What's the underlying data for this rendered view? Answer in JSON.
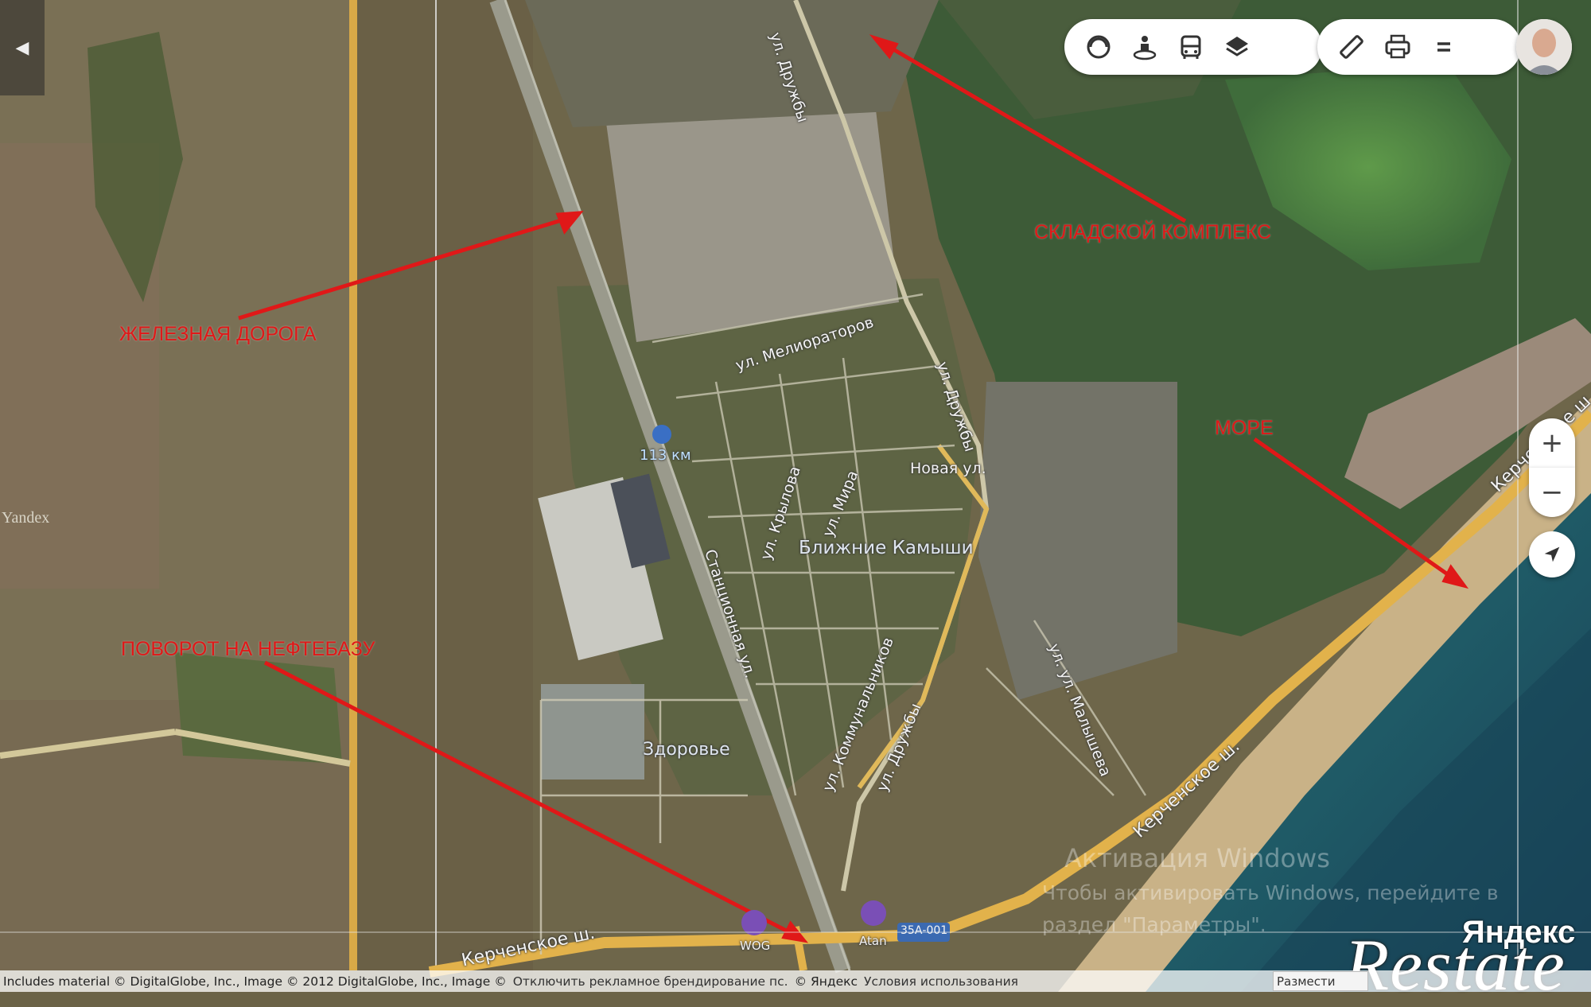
{
  "map": {
    "streets": {
      "druzhby_top": "ул. Дружбы",
      "melioratorov": "ул. Мелиораторов",
      "druzhby_mid": "ул. Дружбы",
      "novaya": "Новая ул.",
      "krylova": "ул. Крылова",
      "mira": "ул. Мира",
      "stantsionnaya": "Станционная ул.",
      "kommunalnikov": "ул. Коммунальников",
      "druzhby_low": "ул. Дружбы",
      "malysheva": "ул. ул. Малышева",
      "kerchenskoe_left": "Керченское ш.",
      "kerchenskoe_mid": "Керченское ш.",
      "kerchenskoe_right": "Керченское ш."
    },
    "places": {
      "settlement": "Ближние Камыши",
      "zdorovye": "Здоровье",
      "station": "113 км",
      "wog": "WOG",
      "atan": "Atan",
      "road_code": "35А-001"
    },
    "annotations": {
      "railway": "ЖЕЛЕЗНАЯ ДОРОГА",
      "warehouse": "СКЛАДСКОЙ КОМПЛЕКС",
      "sea": "МОРЕ",
      "turn": "ПОВОРОТ НА НЕФТЕБАЗУ"
    },
    "annotation_color": "#e01818",
    "side_brand": "Yandex"
  },
  "toolbar": {
    "group1_icons": [
      "traffic-icon",
      "panorama-icon",
      "transit-icon",
      "layers-icon"
    ],
    "group2_icons": [
      "ruler-icon",
      "print-icon",
      "menu-icon"
    ]
  },
  "controls": {
    "zoom_in": "+",
    "zoom_out": "−",
    "locate_icon": "location-arrow-icon"
  },
  "footer": {
    "attribution": "Includes material © DigitalGlobe, Inc., Image © 2012 DigitalGlobe, Inc., Image ©",
    "disable_ads": "Отключить рекламное брендирование пс.",
    "copyright": "© Яндекс",
    "terms": "Условия использования",
    "scale": "Размести"
  },
  "watermark": {
    "line1": "Активация Windows",
    "line2": "Чтобы активировать Windows, перейдите в",
    "line3": "раздел \"Параметры\"."
  },
  "brand": {
    "yandex": "Яндекс",
    "restate": "Restate"
  }
}
